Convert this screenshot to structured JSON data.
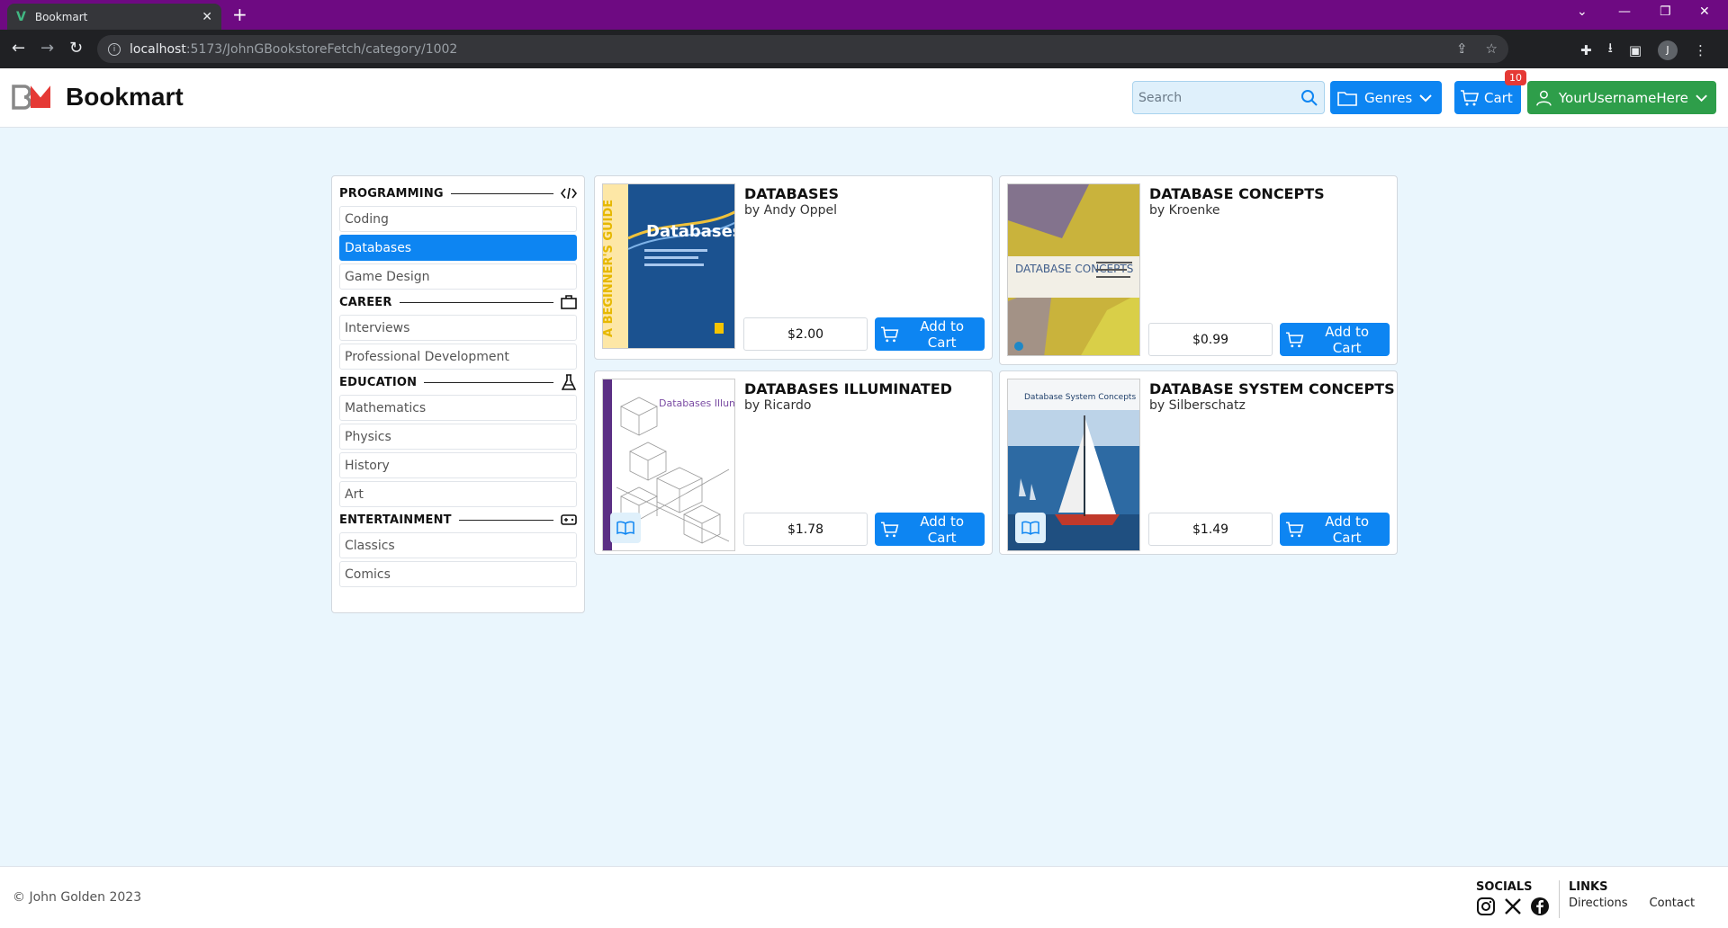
{
  "browser": {
    "tab_title": "Bookmart",
    "url_host": "localhost",
    "url_path": ":5173/JohnGBookstoreFetch/category/1002",
    "profile_initial": "J"
  },
  "header": {
    "logo_text": "Bookmart",
    "search_placeholder": "Search",
    "genres_label": "Genres",
    "cart_label": "Cart",
    "cart_count": "10",
    "user_label": "YourUsernameHere"
  },
  "sidebar": {
    "categories": [
      {
        "title": "PROGRAMMING",
        "icon": "code-icon",
        "items": [
          "Coding",
          "Databases",
          "Game Design"
        ]
      },
      {
        "title": "CAREER",
        "icon": "briefcase-icon",
        "items": [
          "Interviews",
          "Professional Development"
        ]
      },
      {
        "title": "EDUCATION",
        "icon": "flask-icon",
        "items": [
          "Mathematics",
          "Physics",
          "History",
          "Art"
        ]
      },
      {
        "title": "ENTERTAINMENT",
        "icon": "gamepad-icon",
        "items": [
          "Classics",
          "Comics"
        ]
      }
    ],
    "active_item": "Databases"
  },
  "books": [
    {
      "title": "DATABASES",
      "author": "by Andy Oppel",
      "price": "$2.00",
      "button": "Add to Cart",
      "cover_title": "Databases",
      "cover_spine": "A BEGINNER'S GUIDE"
    },
    {
      "title": "DATABASE CONCEPTS",
      "author": "by Kroenke",
      "price": "$0.99",
      "button": "Add to Cart",
      "cover_title": "DATABASE CONCEPTS"
    },
    {
      "title": "DATABASES ILLUMINATED",
      "author": "by Ricardo",
      "price": "$1.78",
      "button": "Add to Cart",
      "cover_title": "Databases Illuminated"
    },
    {
      "title": "DATABASE SYSTEM CONCEPTS",
      "author": "by Silberschatz",
      "price": "$1.49",
      "button": "Add to Cart",
      "cover_title": "Database System Concepts"
    }
  ],
  "footer": {
    "copyright": "© John Golden 2023",
    "socials_heading": "SOCIALS",
    "links_heading": "LINKS",
    "links": [
      "Directions",
      "Contact"
    ]
  },
  "colors": {
    "accent": "#0d85f2",
    "user_button": "#2e9e4a",
    "page_bg": "#eaf6fd",
    "tab_bar": "#6e0a82",
    "badge": "#e53935"
  }
}
